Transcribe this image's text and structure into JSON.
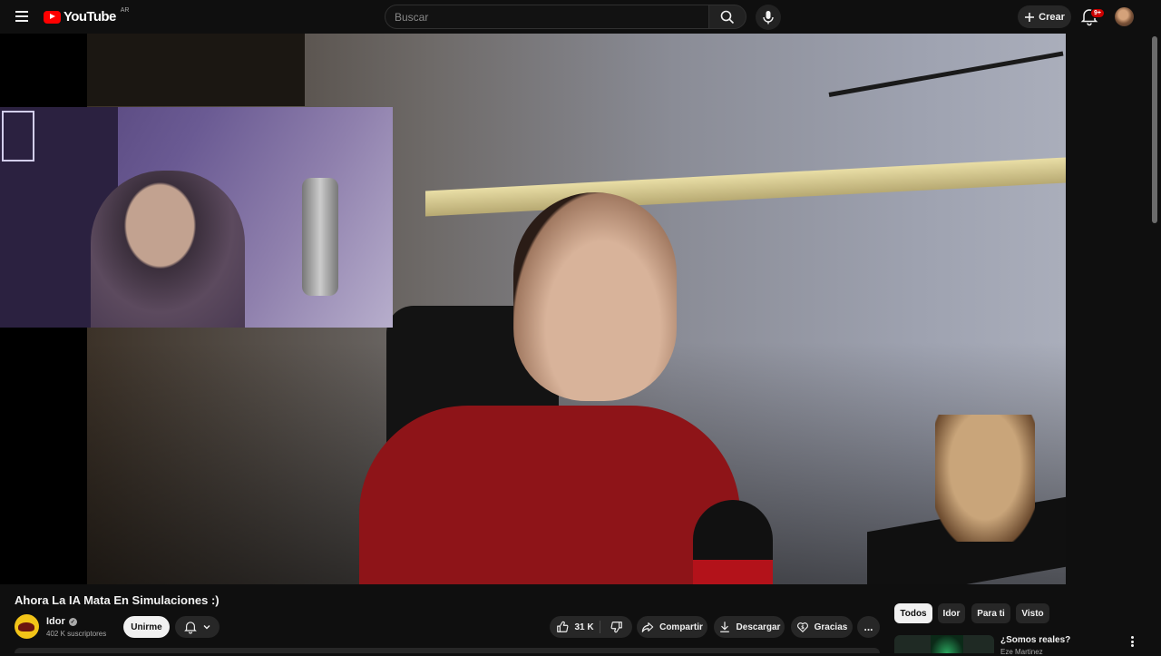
{
  "header": {
    "logo_text": "YouTube",
    "country_code": "AR",
    "search_placeholder": "Buscar",
    "create_label": "Crear",
    "notifications_badge": "9+"
  },
  "video": {
    "title": "Ahora La IA Mata En Simulaciones :)"
  },
  "channel": {
    "name": "Idor",
    "subscribers": "402 K suscriptores",
    "join_label": "Unirme"
  },
  "actions": {
    "likes": "31 K",
    "share_label": "Compartir",
    "download_label": "Descargar",
    "thanks_label": "Gracias",
    "more_label": "..."
  },
  "filter_chips": [
    {
      "label": "Todos",
      "active": true
    },
    {
      "label": "Idor",
      "active": false
    },
    {
      "label": "Para ti",
      "active": false
    },
    {
      "label": "Visto",
      "active": false
    }
  ],
  "recommendations": [
    {
      "title": "¿Somos reales?",
      "channel": "Eze Martinez"
    }
  ],
  "icons": [
    "menu-icon",
    "youtube-logo-icon",
    "search-icon",
    "mic-icon",
    "plus-icon",
    "bell-icon",
    "verified-icon",
    "chevron-down-icon",
    "thumbs-up-icon",
    "thumbs-down-icon",
    "share-icon",
    "download-icon",
    "thanks-icon",
    "more-vert-icon"
  ],
  "colors": {
    "background": "#0f0f0f",
    "brand_red": "#ff0000",
    "chip_bg": "#272727",
    "active_chip_bg": "#f1f1f1"
  }
}
